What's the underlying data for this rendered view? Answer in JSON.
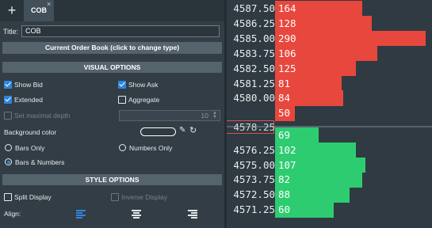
{
  "tabs": {
    "add_icon": "plus-icon",
    "active": "COB",
    "close_glyph": "×"
  },
  "title": {
    "label": "Title:",
    "value": "COB"
  },
  "order_book_button": "Current Order Book (click to change type)",
  "visual_options": {
    "header": "VISUAL OPTIONS",
    "show_bid": {
      "label": "Show Bid",
      "checked": true
    },
    "show_ask": {
      "label": "Show Ask",
      "checked": true
    },
    "extended": {
      "label": "Extended",
      "checked": true
    },
    "aggregate": {
      "label": "Aggregate",
      "checked": false
    },
    "max_depth": {
      "label": "Set maximal depth",
      "checked": false,
      "enabled": false,
      "value": "10"
    },
    "background_color": {
      "label": "Background color"
    },
    "display_mode": {
      "options": [
        "Bars Only",
        "Numbers Only",
        "Bars & Numbers"
      ],
      "selected": "Bars & Numbers"
    }
  },
  "style_options": {
    "header": "STYLE OPTIONS",
    "split_display": {
      "label": "Split Display",
      "checked": false
    },
    "inverse_display": {
      "label": "Inverse Display",
      "checked": false,
      "enabled": false
    },
    "align": {
      "label": "Align:",
      "options": [
        "left",
        "center",
        "right"
      ],
      "selected": "left"
    }
  },
  "colors": {
    "ask": "#e8473d",
    "bid": "#2ecc71",
    "accent": "#2e86de",
    "current_price_border": "#d9534f"
  },
  "order_book": {
    "asks": [
      {
        "price": "4587.50",
        "volume": "164",
        "depth": 0.56
      },
      {
        "price": "4586.25",
        "volume": "128",
        "depth": 0.62
      },
      {
        "price": "4585.00",
        "volume": "290",
        "depth": 0.97
      },
      {
        "price": "4583.75",
        "volume": "106",
        "depth": 0.66
      },
      {
        "price": "4582.50",
        "volume": "125",
        "depth": 0.52
      },
      {
        "price": "4581.25",
        "volume": "81",
        "depth": 0.43
      },
      {
        "price": "4580.00",
        "volume": "84",
        "depth": 0.44
      },
      {
        "price": "",
        "volume": "50",
        "depth": 0.13
      }
    ],
    "current_price": "4578.25",
    "bids": [
      {
        "price": "",
        "volume": "69",
        "depth": 0.28
      },
      {
        "price": "4576.25",
        "volume": "102",
        "depth": 0.52
      },
      {
        "price": "4575.00",
        "volume": "107",
        "depth": 0.58
      },
      {
        "price": "4573.75",
        "volume": "82",
        "depth": 0.56
      },
      {
        "price": "4572.50",
        "volume": "88",
        "depth": 0.48
      },
      {
        "price": "4571.25",
        "volume": "60",
        "depth": 0.38
      }
    ]
  }
}
